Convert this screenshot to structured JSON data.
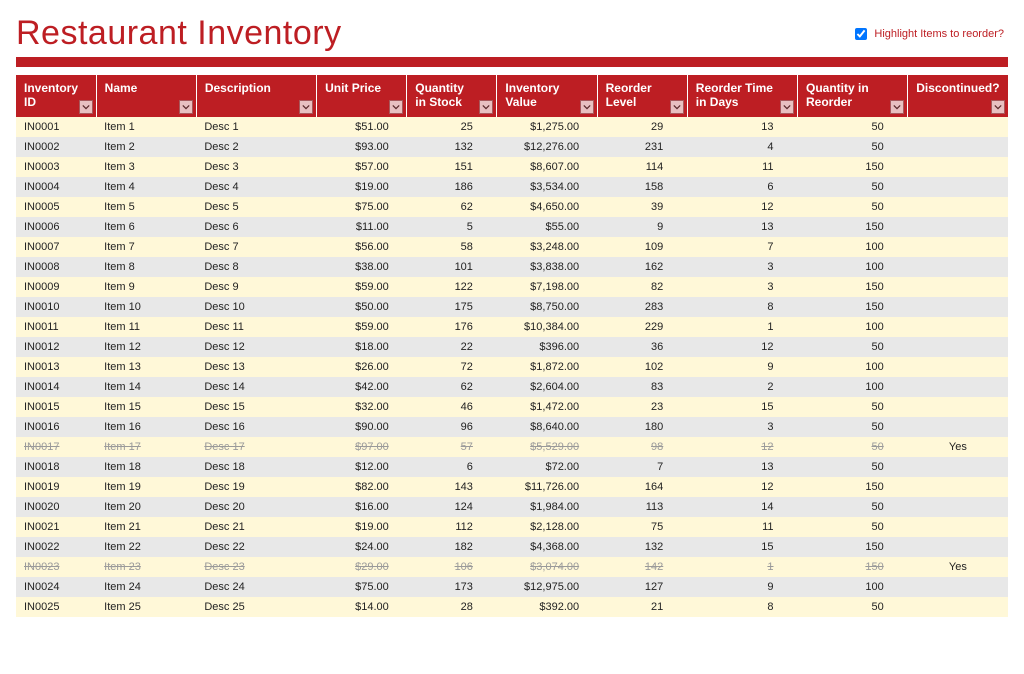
{
  "title": "Restaurant Inventory",
  "highlight": {
    "label": "Highlight Items to reorder?",
    "checked": true
  },
  "columns": [
    {
      "key": "id",
      "label": "Inventory ID",
      "align": "left"
    },
    {
      "key": "name",
      "label": "Name",
      "align": "left"
    },
    {
      "key": "desc",
      "label": "Description",
      "align": "left"
    },
    {
      "key": "price",
      "label": "Unit Price",
      "align": "right"
    },
    {
      "key": "qty",
      "label": "Quantity in Stock",
      "align": "right"
    },
    {
      "key": "value",
      "label": "Inventory Value",
      "align": "right"
    },
    {
      "key": "reorder",
      "label": "Reorder Level",
      "align": "right"
    },
    {
      "key": "time",
      "label": "Reorder Time in Days",
      "align": "right"
    },
    {
      "key": "qreorder",
      "label": "Quantity in Reorder",
      "align": "right"
    },
    {
      "key": "disc",
      "label": "Discontinued?",
      "align": "center"
    }
  ],
  "rows": [
    {
      "id": "IN0001",
      "name": "Item 1",
      "desc": "Desc 1",
      "price": "$51.00",
      "qty": "25",
      "value": "$1,275.00",
      "reorder": "29",
      "time": "13",
      "qreorder": "50",
      "disc": "",
      "discontinued": false
    },
    {
      "id": "IN0002",
      "name": "Item 2",
      "desc": "Desc 2",
      "price": "$93.00",
      "qty": "132",
      "value": "$12,276.00",
      "reorder": "231",
      "time": "4",
      "qreorder": "50",
      "disc": "",
      "discontinued": false
    },
    {
      "id": "IN0003",
      "name": "Item 3",
      "desc": "Desc 3",
      "price": "$57.00",
      "qty": "151",
      "value": "$8,607.00",
      "reorder": "114",
      "time": "11",
      "qreorder": "150",
      "disc": "",
      "discontinued": false
    },
    {
      "id": "IN0004",
      "name": "Item 4",
      "desc": "Desc 4",
      "price": "$19.00",
      "qty": "186",
      "value": "$3,534.00",
      "reorder": "158",
      "time": "6",
      "qreorder": "50",
      "disc": "",
      "discontinued": false
    },
    {
      "id": "IN0005",
      "name": "Item 5",
      "desc": "Desc 5",
      "price": "$75.00",
      "qty": "62",
      "value": "$4,650.00",
      "reorder": "39",
      "time": "12",
      "qreorder": "50",
      "disc": "",
      "discontinued": false
    },
    {
      "id": "IN0006",
      "name": "Item 6",
      "desc": "Desc 6",
      "price": "$11.00",
      "qty": "5",
      "value": "$55.00",
      "reorder": "9",
      "time": "13",
      "qreorder": "150",
      "disc": "",
      "discontinued": false
    },
    {
      "id": "IN0007",
      "name": "Item 7",
      "desc": "Desc 7",
      "price": "$56.00",
      "qty": "58",
      "value": "$3,248.00",
      "reorder": "109",
      "time": "7",
      "qreorder": "100",
      "disc": "",
      "discontinued": false
    },
    {
      "id": "IN0008",
      "name": "Item 8",
      "desc": "Desc 8",
      "price": "$38.00",
      "qty": "101",
      "value": "$3,838.00",
      "reorder": "162",
      "time": "3",
      "qreorder": "100",
      "disc": "",
      "discontinued": false
    },
    {
      "id": "IN0009",
      "name": "Item 9",
      "desc": "Desc 9",
      "price": "$59.00",
      "qty": "122",
      "value": "$7,198.00",
      "reorder": "82",
      "time": "3",
      "qreorder": "150",
      "disc": "",
      "discontinued": false
    },
    {
      "id": "IN0010",
      "name": "Item 10",
      "desc": "Desc 10",
      "price": "$50.00",
      "qty": "175",
      "value": "$8,750.00",
      "reorder": "283",
      "time": "8",
      "qreorder": "150",
      "disc": "",
      "discontinued": false
    },
    {
      "id": "IN0011",
      "name": "Item 11",
      "desc": "Desc 11",
      "price": "$59.00",
      "qty": "176",
      "value": "$10,384.00",
      "reorder": "229",
      "time": "1",
      "qreorder": "100",
      "disc": "",
      "discontinued": false
    },
    {
      "id": "IN0012",
      "name": "Item 12",
      "desc": "Desc 12",
      "price": "$18.00",
      "qty": "22",
      "value": "$396.00",
      "reorder": "36",
      "time": "12",
      "qreorder": "50",
      "disc": "",
      "discontinued": false
    },
    {
      "id": "IN0013",
      "name": "Item 13",
      "desc": "Desc 13",
      "price": "$26.00",
      "qty": "72",
      "value": "$1,872.00",
      "reorder": "102",
      "time": "9",
      "qreorder": "100",
      "disc": "",
      "discontinued": false
    },
    {
      "id": "IN0014",
      "name": "Item 14",
      "desc": "Desc 14",
      "price": "$42.00",
      "qty": "62",
      "value": "$2,604.00",
      "reorder": "83",
      "time": "2",
      "qreorder": "100",
      "disc": "",
      "discontinued": false
    },
    {
      "id": "IN0015",
      "name": "Item 15",
      "desc": "Desc 15",
      "price": "$32.00",
      "qty": "46",
      "value": "$1,472.00",
      "reorder": "23",
      "time": "15",
      "qreorder": "50",
      "disc": "",
      "discontinued": false
    },
    {
      "id": "IN0016",
      "name": "Item 16",
      "desc": "Desc 16",
      "price": "$90.00",
      "qty": "96",
      "value": "$8,640.00",
      "reorder": "180",
      "time": "3",
      "qreorder": "50",
      "disc": "",
      "discontinued": false
    },
    {
      "id": "IN0017",
      "name": "Item 17",
      "desc": "Desc 17",
      "price": "$97.00",
      "qty": "57",
      "value": "$5,529.00",
      "reorder": "98",
      "time": "12",
      "qreorder": "50",
      "disc": "Yes",
      "discontinued": true
    },
    {
      "id": "IN0018",
      "name": "Item 18",
      "desc": "Desc 18",
      "price": "$12.00",
      "qty": "6",
      "value": "$72.00",
      "reorder": "7",
      "time": "13",
      "qreorder": "50",
      "disc": "",
      "discontinued": false
    },
    {
      "id": "IN0019",
      "name": "Item 19",
      "desc": "Desc 19",
      "price": "$82.00",
      "qty": "143",
      "value": "$11,726.00",
      "reorder": "164",
      "time": "12",
      "qreorder": "150",
      "disc": "",
      "discontinued": false
    },
    {
      "id": "IN0020",
      "name": "Item 20",
      "desc": "Desc 20",
      "price": "$16.00",
      "qty": "124",
      "value": "$1,984.00",
      "reorder": "113",
      "time": "14",
      "qreorder": "50",
      "disc": "",
      "discontinued": false
    },
    {
      "id": "IN0021",
      "name": "Item 21",
      "desc": "Desc 21",
      "price": "$19.00",
      "qty": "112",
      "value": "$2,128.00",
      "reorder": "75",
      "time": "11",
      "qreorder": "50",
      "disc": "",
      "discontinued": false
    },
    {
      "id": "IN0022",
      "name": "Item 22",
      "desc": "Desc 22",
      "price": "$24.00",
      "qty": "182",
      "value": "$4,368.00",
      "reorder": "132",
      "time": "15",
      "qreorder": "150",
      "disc": "",
      "discontinued": false
    },
    {
      "id": "IN0023",
      "name": "Item 23",
      "desc": "Desc 23",
      "price": "$29.00",
      "qty": "106",
      "value": "$3,074.00",
      "reorder": "142",
      "time": "1",
      "qreorder": "150",
      "disc": "Yes",
      "discontinued": true
    },
    {
      "id": "IN0024",
      "name": "Item 24",
      "desc": "Desc 24",
      "price": "$75.00",
      "qty": "173",
      "value": "$12,975.00",
      "reorder": "127",
      "time": "9",
      "qreorder": "100",
      "disc": "",
      "discontinued": false
    },
    {
      "id": "IN0025",
      "name": "Item 25",
      "desc": "Desc 25",
      "price": "$14.00",
      "qty": "28",
      "value": "$392.00",
      "reorder": "21",
      "time": "8",
      "qreorder": "50",
      "disc": "",
      "discontinued": false
    }
  ]
}
